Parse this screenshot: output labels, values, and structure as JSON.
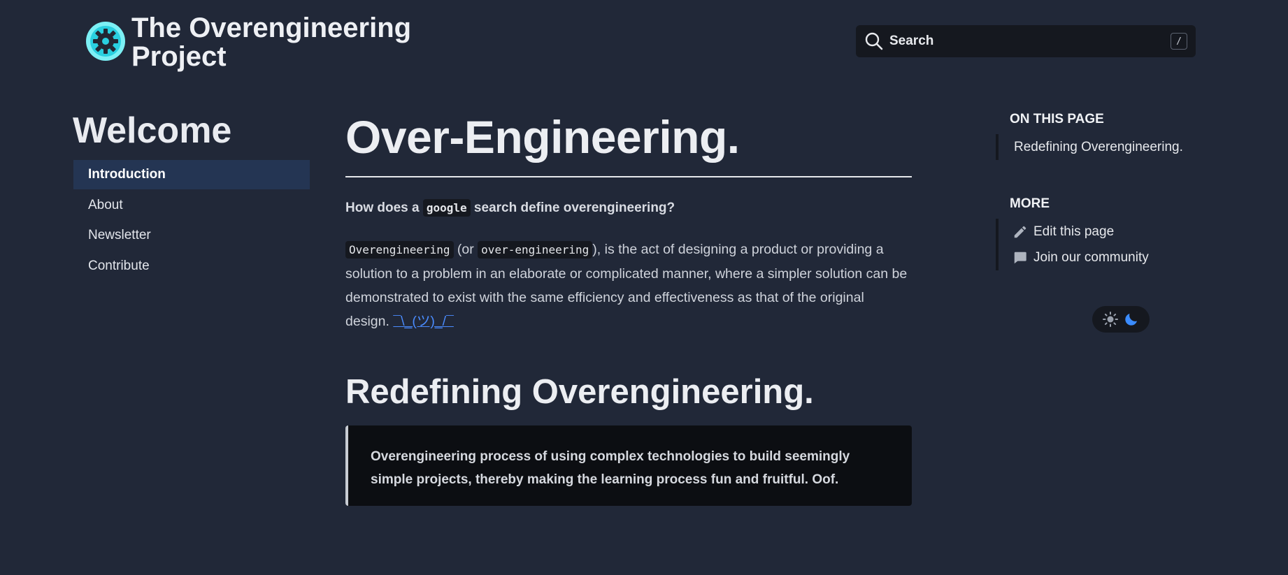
{
  "header": {
    "logo_icon": "gear-icon",
    "title": "The Overengineering Project",
    "search": {
      "label": "Search",
      "shortcut": "/"
    }
  },
  "sidebar": {
    "title": "Welcome",
    "items": [
      {
        "label": "Introduction",
        "active": true
      },
      {
        "label": "About",
        "active": false
      },
      {
        "label": "Newsletter",
        "active": false
      },
      {
        "label": "Contribute",
        "active": false
      }
    ]
  },
  "main": {
    "title": "Over-Engineering.",
    "question": {
      "before": "How does a ",
      "code": "google",
      "after": " search define overengineering?"
    },
    "paragraph": {
      "code1": "Overengineering",
      "text1": " (or ",
      "code2": "over-engineering",
      "text2": "), is the act of designing a product or providing a solution to a problem in an elaborate or complicated manner, where a simpler solution can be demonstrated to exist with the same efficiency and effectiveness as that of the original design. ",
      "link": "¯\\_(ツ)_/¯"
    },
    "section_title": "Redefining Overengineering.",
    "quote": "Overengineering process of using complex technologies to build seemingly simple projects, thereby making the learning process fun and fruitful. Oof."
  },
  "toc": {
    "heading": "ON THIS PAGE",
    "links": [
      "Redefining Overengineering."
    ]
  },
  "more": {
    "heading": "MORE",
    "edit": {
      "label": "Edit this page",
      "icon": "pencil-icon"
    },
    "community": {
      "label": "Join our community",
      "icon": "chat-bubble-icon"
    }
  },
  "theme_toggle": {
    "light_icon": "sun-icon",
    "dark_icon": "moon-icon",
    "active": "dark"
  },
  "colors": {
    "background": "#212838",
    "active_nav": "#243553",
    "link": "#4a8cff",
    "logo_accent": "#3ee6f0"
  }
}
